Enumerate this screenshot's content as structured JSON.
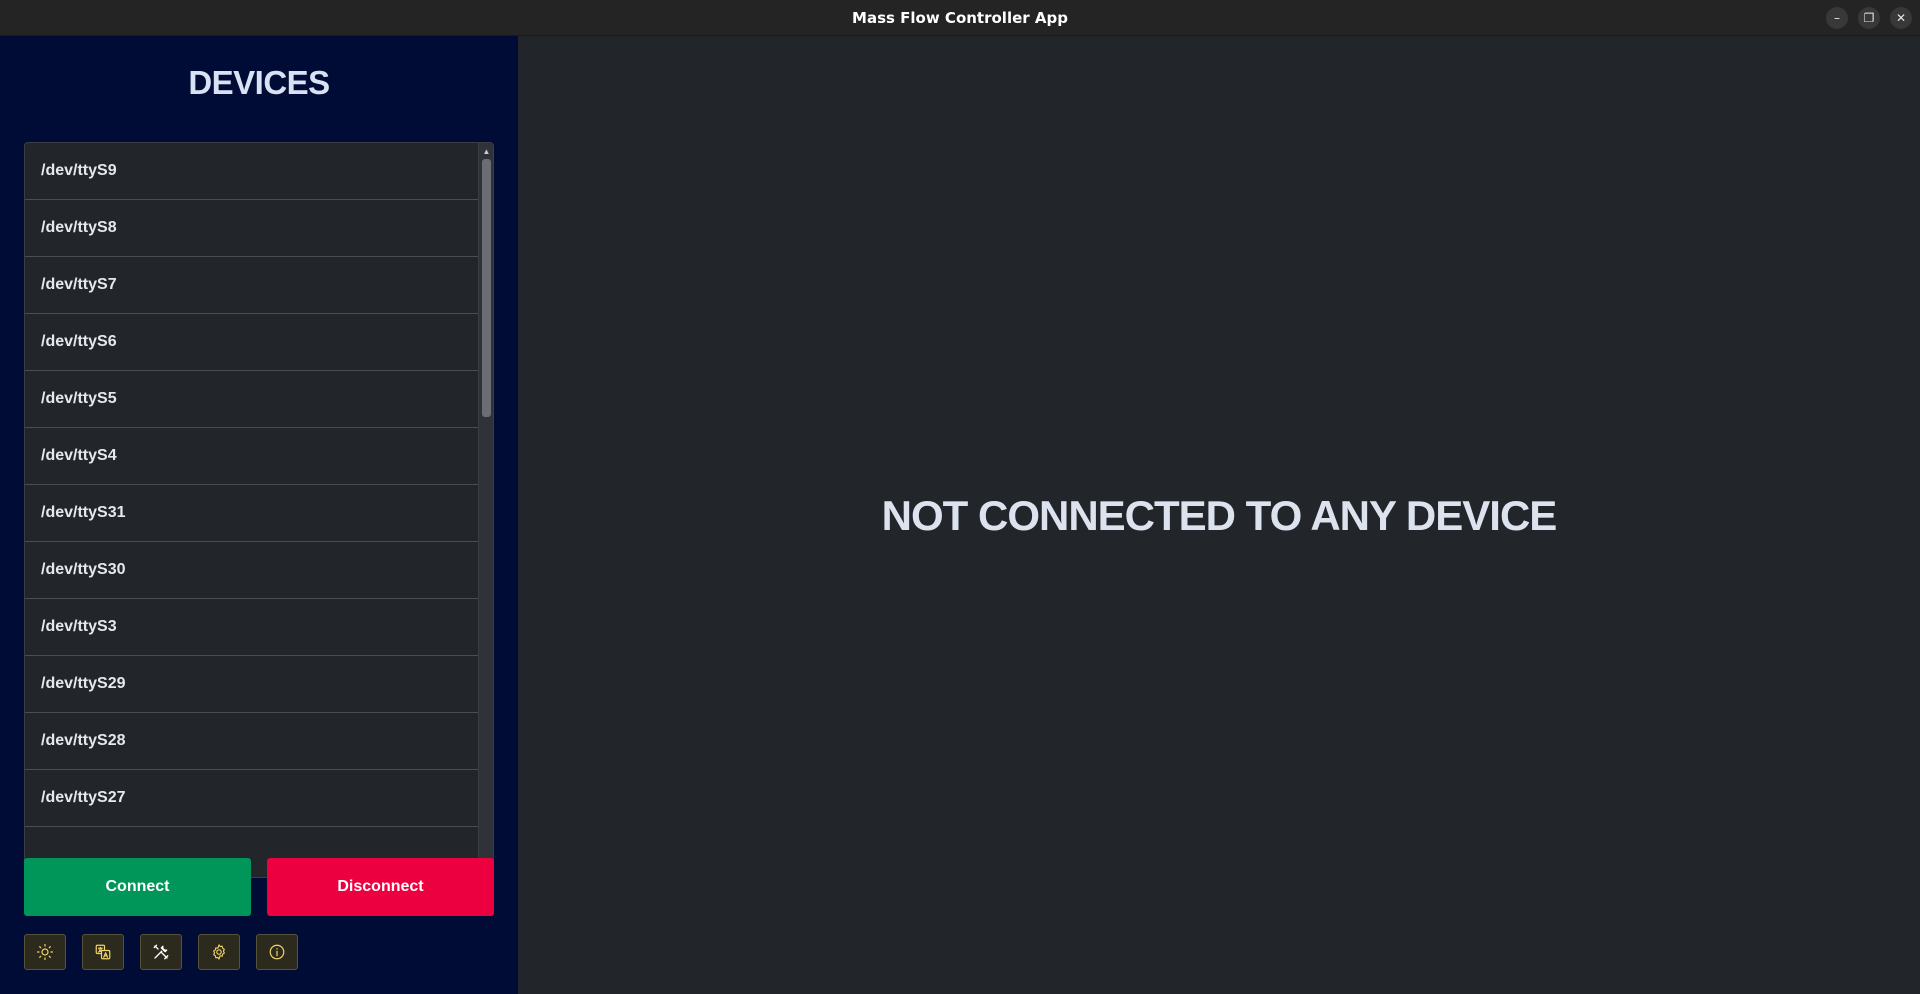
{
  "window": {
    "title": "Mass Flow Controller App",
    "controls": {
      "minimize": "–",
      "restore": "❐",
      "close": "✕"
    }
  },
  "sidebar": {
    "heading": "DEVICES",
    "devices": [
      "/dev/ttyS9",
      "/dev/ttyS8",
      "/dev/ttyS7",
      "/dev/ttyS6",
      "/dev/ttyS5",
      "/dev/ttyS4",
      "/dev/ttyS31",
      "/dev/ttyS30",
      "/dev/ttyS3",
      "/dev/ttyS29",
      "/dev/ttyS28",
      "/dev/ttyS27"
    ],
    "connect_label": "Connect",
    "disconnect_label": "Disconnect",
    "tools": [
      {
        "icon": "sun-icon"
      },
      {
        "icon": "translate-icon"
      },
      {
        "icon": "tools-icon"
      },
      {
        "icon": "gear-icon"
      },
      {
        "icon": "info-icon"
      }
    ]
  },
  "main": {
    "status": "NOT CONNECTED TO ANY DEVICE"
  },
  "colors": {
    "sidebar_bg": "#000c35",
    "main_bg": "#22252a",
    "connect": "#00965a",
    "disconnect": "#ec003f",
    "tool_border": "#57523a"
  }
}
